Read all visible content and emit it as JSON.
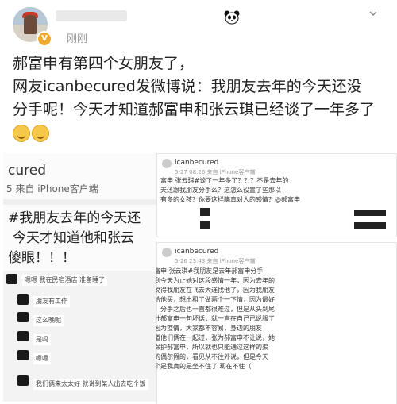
{
  "post": {
    "time": "刚刚",
    "lines": [
      "郝富申有第四个女朋友了，",
      "网友icanbecured发微博说：我朋友去年的今天还没",
      "分手呢！今天才知道郝富申和张云琪已经谈了一年多了"
    ]
  },
  "left_shot": {
    "name": "cured",
    "meta": "5  来自 iPhone客户端",
    "text_lines": [
      "#我朋友去年的今天还",
      "今天才知道他和张云",
      "傻眼！！！"
    ],
    "chat_rows": [
      "嗯嗯 我在民宿酒店 准备睡了",
      "朋友有工作",
      "这么晚呢",
      "是吗",
      "嗯嗯",
      "我们俩来太太好 就说到某人出去吃个饭"
    ]
  },
  "right_shot": {
    "card1": {
      "name": "icanbecured",
      "meta": "5-27 08:26  来自 iPhone客户端",
      "lines": [
        "富申 张云琪#谈了一年多了？？？不是去年的",
        "天还跟我朋友分手么？这怎么设置了些那以",
        "有多的女孩？你要这样瞒真对人的感情？@郝富申"
      ]
    },
    "card2": {
      "name": "icanbecured",
      "meta": "5-26 23:43  来自 iPhone客户端",
      "lines": [
        "富申 张云琪#我朋友是去年郝富申分手",
        "到今天为止她对这段感情一年，因为去年的",
        "说得我朋友在飞去大连找他了，因为我朋友",
        "给他买，想出租了做两个一下情，因为最好",
        "，分手之后也一直都很难过，但是从头到尾",
        "社郝富申一句坏话，就一直在自己已说服了",
        "因为疫情，大家都不容易，身边的朋友",
        "道他们俩在一起过，张为郝富申不让说，她",
        "保护郝富申，所以就也只能通过这样的渠",
        "的偶尔假的，看见从不往外说，但是今天",
        "个是我真的是坐不住了 现在不住（"
      ]
    }
  }
}
